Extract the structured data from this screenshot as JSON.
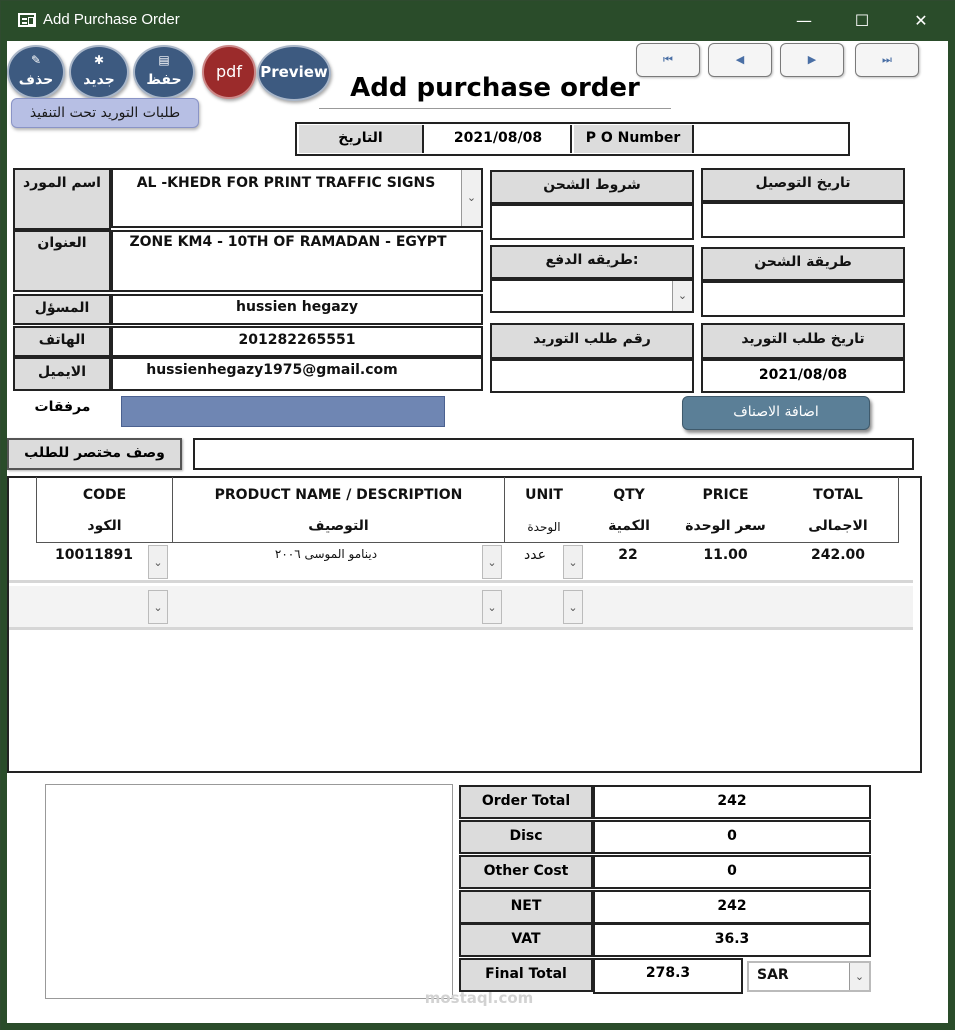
{
  "window": {
    "title": "Add Purchase Order",
    "minimize": "—",
    "maximize": "☐",
    "close": "✕"
  },
  "toolbar": {
    "delete_label": "حذف",
    "new_label": "جديد",
    "save_label": "حفظ",
    "pdf_label": "pdf",
    "preview_label": "Preview",
    "pending_orders_label": "طلبات التوريد تحت التنفيذ"
  },
  "nav": {
    "first": "⏮",
    "prev": "◀",
    "next": "▶",
    "last": "⏭"
  },
  "form": {
    "heading": "Add purchase order",
    "date_label": "التاريخ",
    "date_value": "2021/08/08",
    "po_number_label": "P O Number",
    "po_number_value": ""
  },
  "supplier": {
    "name_label": "اسم المورد",
    "name_value": "AL -KHEDR FOR PRINT TRAFFIC SIGNS",
    "address_label": "العنوان",
    "address_value": "ZONE KM4 - 10TH OF RAMADAN - EGYPT",
    "contact_label": "المسؤل",
    "contact_value": "hussien hegazy",
    "phone_label": "الهاتف",
    "phone_value": "201282265551",
    "email_label": "الايميل",
    "email_value": "hussienhegazy1975@gmail.com",
    "attachments_label": "مرفقات",
    "short_desc_label": "وصف مختصر للطلب",
    "short_desc_value": ""
  },
  "shipping": {
    "shipping_terms_label": "شروط الشحن",
    "shipping_terms_value": "",
    "delivery_date_label": "تاريخ التوصيل",
    "delivery_date_value": "",
    "payment_method_label": "طريقه الدفع:",
    "payment_method_value": "",
    "shipping_method_label": "طريقة الشحن",
    "shipping_method_value": "",
    "request_number_label": "رقم طلب التوريد",
    "request_number_value": "",
    "request_date_label": "تاريخ طلب التوريد",
    "request_date_value": "2021/08/08",
    "add_items_label": "اضافة الاصناف"
  },
  "grid": {
    "headers": [
      {
        "en": "CODE",
        "ar": "الكود"
      },
      {
        "en": "PRODUCT NAME / DESCRIPTION",
        "ar": "التوصيف"
      },
      {
        "en": "UNIT",
        "ar": "الوحدة"
      },
      {
        "en": "QTY",
        "ar": "الكمية"
      },
      {
        "en": "PRICE",
        "ar": "سعر الوحدة"
      },
      {
        "en": "TOTAL",
        "ar": "الاجمالى"
      }
    ],
    "rows": [
      {
        "code": "10011891",
        "description": "دينامو الموسى ٢٠٠٦",
        "unit": "عدد",
        "qty": "22",
        "price": "11.00",
        "total": "242.00"
      }
    ]
  },
  "summary": {
    "order_total_label": "Order Total",
    "order_total_value": "242",
    "disc_label": "Disc",
    "disc_value": "0",
    "other_cost_label": "Other Cost",
    "other_cost_value": "0",
    "net_label": "NET",
    "net_value": "242",
    "vat_label": "VAT",
    "vat_value": "36.3",
    "final_total_label": "Final Total",
    "final_total_value": "278.3",
    "currency_value": "SAR"
  },
  "watermark": {
    "text": "mostaql.com"
  }
}
